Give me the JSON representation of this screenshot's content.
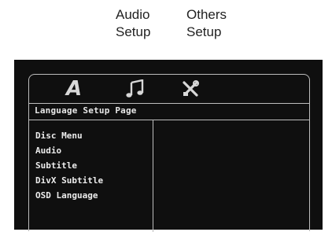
{
  "captions": {
    "audio_setup": [
      "Audio",
      "Setup"
    ],
    "others_setup": [
      "Others",
      "Setup"
    ]
  },
  "tabs": [
    {
      "icon": "language-a-icon",
      "glyph": "A"
    },
    {
      "icon": "music-note-icon"
    },
    {
      "icon": "tools-icon"
    }
  ],
  "page_title": "Language Setup Page",
  "menu": {
    "items": [
      "Disc Menu",
      "Audio",
      "Subtitle",
      "DivX Subtitle",
      "OSD Language"
    ]
  },
  "colors": {
    "screen_bg": "#0f0f0f",
    "frame_line": "#bdbdbd",
    "text": "#ececec"
  }
}
